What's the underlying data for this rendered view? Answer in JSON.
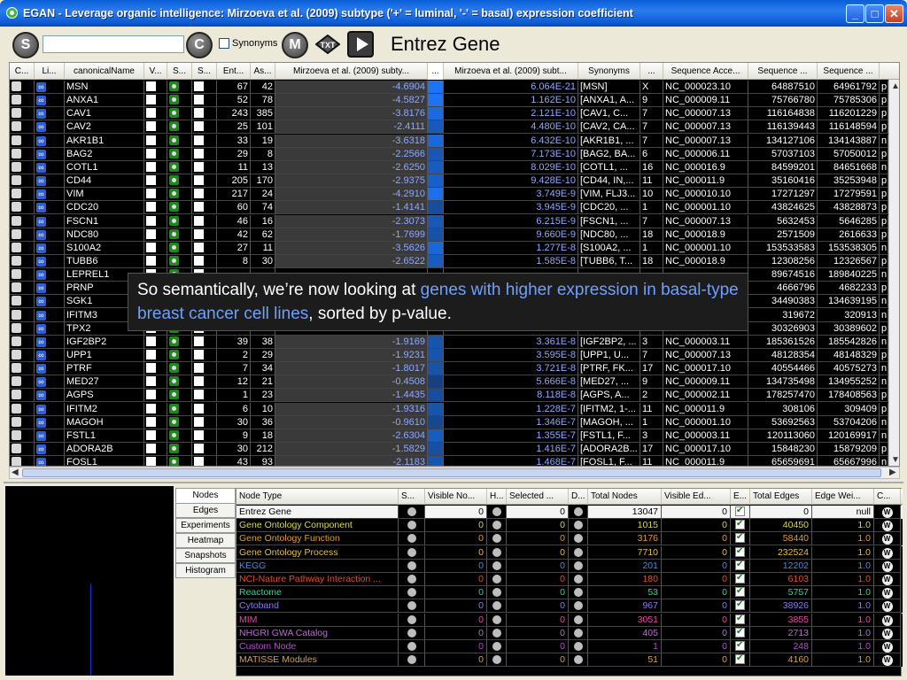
{
  "window": {
    "title": "EGAN - Leverage organic intelligence: Mirzoeva et al. (2009) subtype ('+' = luminal, '-' = basal) expression coefficient",
    "minimize": "_",
    "maximize": "□",
    "close": "✕"
  },
  "toolbar": {
    "search_button": "S",
    "search_value": "",
    "clear_button": "C",
    "synonyms_label": "Synonyms",
    "m_button": "M",
    "txt_button": "TXT",
    "mode_label": "Entrez Gene"
  },
  "grid": {
    "columns": [
      "C...",
      "Li...",
      "canonicalName",
      "V...",
      "S...",
      "S...",
      "Ent...",
      "As...",
      "Mirzoeva et al. (2009) subty...",
      "...",
      "Mirzoeva et al. (2009) subt...",
      "Synonyms",
      "...",
      "Sequence Acce...",
      "Sequence ...",
      "Sequence ..."
    ],
    "rows": [
      {
        "name": "MSN",
        "ent": "67",
        "as": "42",
        "coef": "-4.6904",
        "pval": "6.064E-21",
        "syn": "[MSN]",
        "chr": "X",
        "acc": "NC_000023.10",
        "s1": "64887510",
        "s2": "64961792",
        "x": "p"
      },
      {
        "name": "ANXA1",
        "ent": "52",
        "as": "78",
        "coef": "-4.5827",
        "pval": "1.162E-10",
        "syn": "[ANXA1, A...",
        "chr": "9",
        "acc": "NC_000009.11",
        "s1": "75766780",
        "s2": "75785306",
        "x": "p"
      },
      {
        "name": "CAV1",
        "ent": "243",
        "as": "385",
        "coef": "-3.8176",
        "pval": "2.121E-10",
        "syn": "[CAV1, C...",
        "chr": "7",
        "acc": "NC_000007.13",
        "s1": "116164838",
        "s2": "116201229",
        "x": "p"
      },
      {
        "name": "CAV2",
        "ent": "25",
        "as": "101",
        "coef": "-2.4111",
        "pval": "4.480E-10",
        "syn": "[CAV2, CA...",
        "chr": "7",
        "acc": "NC_000007.13",
        "s1": "116139443",
        "s2": "116148594",
        "x": "p"
      },
      {
        "name": "AKR1B1",
        "ent": "33",
        "as": "19",
        "coef": "-3.6318",
        "pval": "6.432E-10",
        "syn": "[AKR1B1, ...",
        "chr": "7",
        "acc": "NC_000007.13",
        "s1": "134127106",
        "s2": "134143887",
        "x": "n"
      },
      {
        "name": "BAG2",
        "ent": "29",
        "as": "8",
        "coef": "-2.2566",
        "pval": "7.173E-10",
        "syn": "[BAG2, BA...",
        "chr": "6",
        "acc": "NC_000006.11",
        "s1": "57037103",
        "s2": "57050012",
        "x": "p"
      },
      {
        "name": "COTL1",
        "ent": "11",
        "as": "13",
        "coef": "-2.6250",
        "pval": "8.029E-10",
        "syn": "[COTL1, ...",
        "chr": "16",
        "acc": "NC_000016.9",
        "s1": "84599201",
        "s2": "84651668",
        "x": "n"
      },
      {
        "name": "CD44",
        "ent": "205",
        "as": "170",
        "coef": "-2.9375",
        "pval": "9.428E-10",
        "syn": "[CD44, IN,...",
        "chr": "11",
        "acc": "NC_000011.9",
        "s1": "35160416",
        "s2": "35253948",
        "x": "p"
      },
      {
        "name": "VIM",
        "ent": "217",
        "as": "24",
        "coef": "-4.2910",
        "pval": "3.749E-9",
        "syn": "[VIM, FLJ3...",
        "chr": "10",
        "acc": "NC_000010.10",
        "s1": "17271297",
        "s2": "17279591",
        "x": "p"
      },
      {
        "name": "CDC20",
        "ent": "60",
        "as": "74",
        "coef": "-1.4141",
        "pval": "3.945E-9",
        "syn": "[CDC20, ...",
        "chr": "1",
        "acc": "NC_000001.10",
        "s1": "43824625",
        "s2": "43828873",
        "x": "p"
      },
      {
        "name": "FSCN1",
        "ent": "46",
        "as": "16",
        "coef": "-2.3073",
        "pval": "6.215E-9",
        "syn": "[FSCN1, ...",
        "chr": "7",
        "acc": "NC_000007.13",
        "s1": "5632453",
        "s2": "5646285",
        "x": "p"
      },
      {
        "name": "NDC80",
        "ent": "42",
        "as": "62",
        "coef": "-1.7699",
        "pval": "9.660E-9",
        "syn": "[NDC80, ...",
        "chr": "18",
        "acc": "NC_000018.9",
        "s1": "2571509",
        "s2": "2616633",
        "x": "p"
      },
      {
        "name": "S100A2",
        "ent": "27",
        "as": "11",
        "coef": "-3.5626",
        "pval": "1.277E-8",
        "syn": "[S100A2, ...",
        "chr": "1",
        "acc": "NC_000001.10",
        "s1": "153533583",
        "s2": "153538305",
        "x": "n"
      },
      {
        "name": "TUBB6",
        "ent": "8",
        "as": "30",
        "coef": "-2.6522",
        "pval": "1.585E-8",
        "syn": "[TUBB6, T...",
        "chr": "18",
        "acc": "NC_000018.9",
        "s1": "12308256",
        "s2": "12326567",
        "x": "p"
      },
      {
        "name": "LEPREL1",
        "ent": "",
        "as": "",
        "coef": "",
        "pval": "",
        "syn": "",
        "chr": "",
        "acc": "",
        "s1": "89674516",
        "s2": "189840225",
        "x": "n"
      },
      {
        "name": "PRNP",
        "ent": "",
        "as": "",
        "coef": "",
        "pval": "",
        "syn": "",
        "chr": "",
        "acc": "",
        "s1": "4666796",
        "s2": "4682233",
        "x": "p"
      },
      {
        "name": "SGK1",
        "ent": "",
        "as": "",
        "coef": "",
        "pval": "",
        "syn": "",
        "chr": "",
        "acc": "",
        "s1": "34490383",
        "s2": "134639195",
        "x": "n"
      },
      {
        "name": "IFITM3",
        "ent": "",
        "as": "",
        "coef": "",
        "pval": "",
        "syn": "",
        "chr": "",
        "acc": "",
        "s1": "319672",
        "s2": "320913",
        "x": "n"
      },
      {
        "name": "TPX2",
        "ent": "",
        "as": "",
        "coef": "",
        "pval": "",
        "syn": "",
        "chr": "",
        "acc": "",
        "s1": "30326903",
        "s2": "30389602",
        "x": "p"
      },
      {
        "name": "IGF2BP2",
        "ent": "39",
        "as": "38",
        "coef": "-1.9169",
        "pval": "3.361E-8",
        "syn": "[IGF2BP2, ...",
        "chr": "3",
        "acc": "NC_000003.11",
        "s1": "185361526",
        "s2": "185542826",
        "x": "n"
      },
      {
        "name": "UPP1",
        "ent": "2",
        "as": "29",
        "coef": "-1.9231",
        "pval": "3.595E-8",
        "syn": "[UPP1, U...",
        "chr": "7",
        "acc": "NC_000007.13",
        "s1": "48128354",
        "s2": "48148329",
        "x": "p"
      },
      {
        "name": "PTRF",
        "ent": "7",
        "as": "34",
        "coef": "-1.8017",
        "pval": "3.721E-8",
        "syn": "[PTRF, FK...",
        "chr": "17",
        "acc": "NC_000017.10",
        "s1": "40554466",
        "s2": "40575273",
        "x": "n"
      },
      {
        "name": "MED27",
        "ent": "12",
        "as": "21",
        "coef": "-0.4508",
        "pval": "5.666E-8",
        "syn": "[MED27, ...",
        "chr": "9",
        "acc": "NC_000009.11",
        "s1": "134735498",
        "s2": "134955252",
        "x": "n"
      },
      {
        "name": "AGPS",
        "ent": "1",
        "as": "23",
        "coef": "-1.4435",
        "pval": "8.118E-8",
        "syn": "[AGPS, A...",
        "chr": "2",
        "acc": "NC_000002.11",
        "s1": "178257470",
        "s2": "178408563",
        "x": "p"
      },
      {
        "name": "IFITM2",
        "ent": "6",
        "as": "10",
        "coef": "-1.9316",
        "pval": "1.228E-7",
        "syn": "[IFITM2, 1-...",
        "chr": "11",
        "acc": "NC_000011.9",
        "s1": "308106",
        "s2": "309409",
        "x": "p"
      },
      {
        "name": "MAGOH",
        "ent": "30",
        "as": "36",
        "coef": "-0.9610",
        "pval": "1.346E-7",
        "syn": "[MAGOH, ...",
        "chr": "1",
        "acc": "NC_000001.10",
        "s1": "53692563",
        "s2": "53704206",
        "x": "n"
      },
      {
        "name": "FSTL1",
        "ent": "9",
        "as": "18",
        "coef": "-2.6304",
        "pval": "1.355E-7",
        "syn": "[FSTL1, F...",
        "chr": "3",
        "acc": "NC_000003.11",
        "s1": "120113060",
        "s2": "120169917",
        "x": "n"
      },
      {
        "name": "ADORA2B",
        "ent": "30",
        "as": "212",
        "coef": "-1.5829",
        "pval": "1.416E-7",
        "syn": "[ADORA2B...",
        "chr": "17",
        "acc": "NC_000017.10",
        "s1": "15848230",
        "s2": "15879209",
        "x": "p"
      },
      {
        "name": "FOSL1",
        "ent": "43",
        "as": "93",
        "coef": "-2.1183",
        "pval": "1.468E-7",
        "syn": "[FOSL1, F...",
        "chr": "11",
        "acc": "NC_000011.9",
        "s1": "65659691",
        "s2": "65667996",
        "x": "n"
      }
    ]
  },
  "callout": {
    "before": "So semantically, we’re now looking at ",
    "highlight": "genes with higher expression in basal-type breast cancer cell lines",
    "after": ", sorted by p-value."
  },
  "tabs": [
    "Nodes",
    "Edges",
    "Experiments",
    "Heatmap",
    "Snapshots",
    "Histogram"
  ],
  "node_table": {
    "columns": [
      "Node Type",
      "S...",
      "Visible No...",
      "H...",
      "Selected ...",
      "D...",
      "Total Nodes",
      "Visible Ed...",
      "E...",
      "Total Edges",
      "Edge Wei...",
      "C..."
    ],
    "rows": [
      {
        "type": "Entrez Gene",
        "color": "#000000",
        "bg": "#f4f4f4",
        "visible": "0",
        "selected": "0",
        "total": "13047",
        "vedges": "0",
        "tedges": "0",
        "weight": "null"
      },
      {
        "type": "Gene Ontology Component",
        "color": "#d8d84a",
        "bg": "#000000",
        "visible": "0",
        "selected": "0",
        "total": "1015",
        "vedges": "0",
        "tedges": "40450",
        "weight": "1.0"
      },
      {
        "type": "Gene Ontology Function",
        "color": "#e09a30",
        "bg": "#000000",
        "visible": "0",
        "selected": "0",
        "total": "3176",
        "vedges": "0",
        "tedges": "58440",
        "weight": "1.0"
      },
      {
        "type": "Gene Ontology Process",
        "color": "#e0c040",
        "bg": "#000000",
        "visible": "0",
        "selected": "0",
        "total": "7710",
        "vedges": "0",
        "tedges": "232524",
        "weight": "1.0"
      },
      {
        "type": "KEGG",
        "color": "#4a8ae8",
        "bg": "#000000",
        "visible": "0",
        "selected": "0",
        "total": "201",
        "vedges": "0",
        "tedges": "12202",
        "weight": "1.0"
      },
      {
        "type": "NCI-Nature Pathway Interaction ...",
        "color": "#e05030",
        "bg": "#000000",
        "visible": "0",
        "selected": "0",
        "total": "180",
        "vedges": "0",
        "tedges": "6103",
        "weight": "1.0"
      },
      {
        "type": "Reactome",
        "color": "#30d0a0",
        "bg": "#000000",
        "visible": "0",
        "selected": "0",
        "total": "53",
        "vedges": "0",
        "tedges": "5757",
        "weight": "1.0"
      },
      {
        "type": "Cytoband",
        "color": "#8a7ae8",
        "bg": "#000000",
        "visible": "0",
        "selected": "0",
        "total": "967",
        "vedges": "0",
        "tedges": "38926",
        "weight": "1.0"
      },
      {
        "type": "MIM",
        "color": "#e04aa0",
        "bg": "#000000",
        "visible": "0",
        "selected": "0",
        "total": "3051",
        "vedges": "0",
        "tedges": "3855",
        "weight": "1.0"
      },
      {
        "type": "NHGRI GWA Catalog",
        "color": "#c06ad8",
        "bg": "#000000",
        "visible": "0",
        "selected": "0",
        "total": "405",
        "vedges": "0",
        "tedges": "2713",
        "weight": "1.0"
      },
      {
        "type": "Custom Node",
        "color": "#b04ad0",
        "bg": "#000000",
        "visible": "0",
        "selected": "0",
        "total": "1",
        "vedges": "0",
        "tedges": "248",
        "weight": "1.0"
      },
      {
        "type": "MATISSE Modules",
        "color": "#e0a030",
        "bg": "#000000",
        "visible": "0",
        "selected": "0",
        "total": "51",
        "vedges": "0",
        "tedges": "4160",
        "weight": "1.0"
      }
    ]
  }
}
